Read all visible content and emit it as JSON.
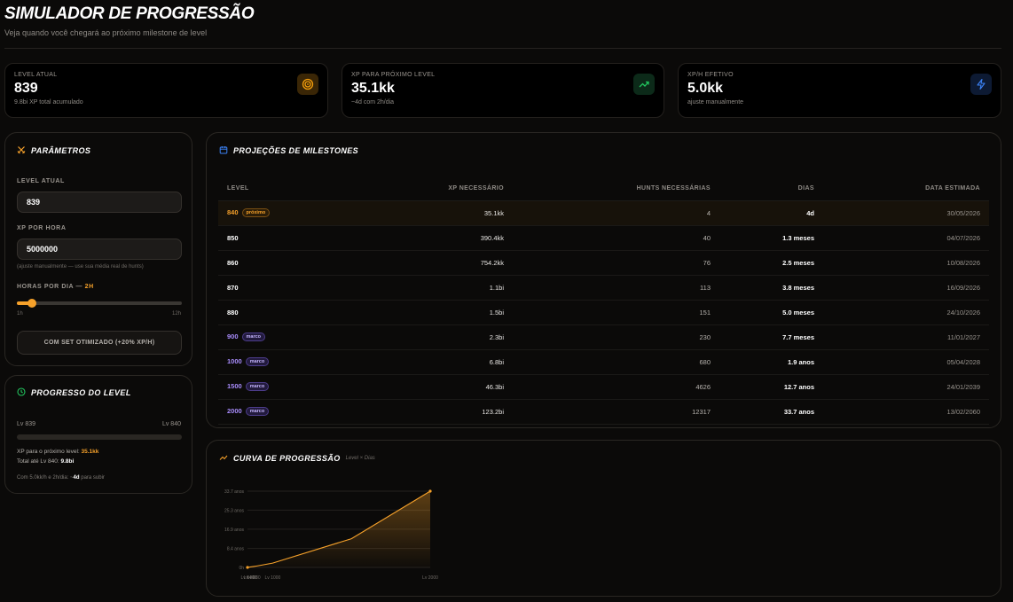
{
  "header": {
    "title": "SIMULADOR DE PROGRESSÃO",
    "subtitle": "Veja quando você chegará ao próximo milestone de level"
  },
  "stats": [
    {
      "label": "LEVEL ATUAL",
      "value": "839",
      "sub": "9.8bi XP total acumulado",
      "icon": "target-icon",
      "color": "#f59e0b"
    },
    {
      "label": "XP PARA PRÓXIMO LEVEL",
      "value": "35.1kk",
      "sub": "~4d com 2h/dia",
      "icon": "trending-up-icon",
      "color": "#22c55e"
    },
    {
      "label": "XP/H EFETIVO",
      "value": "5.0kk",
      "sub": "ajuste manualmente",
      "icon": "lightning-icon",
      "color": "#3b82f6"
    }
  ],
  "params": {
    "title": "PARÂMETROS",
    "level_label": "LEVEL ATUAL",
    "level_value": "839",
    "xp_label": "XP POR HORA",
    "xp_value": "5000000",
    "xp_hint": "(ajuste manualmente — use sua média real de hunts)",
    "hours_label": "HORAS POR DIA —",
    "hours_value": "2H",
    "hours_fraction": 0.0909,
    "slider_min": "1h",
    "slider_max": "12h",
    "set_button": "COM SET OTIMIZADO (+20% XP/H)"
  },
  "progress": {
    "title": "PROGRESSO DO LEVEL",
    "from": "Lv 839",
    "to": "Lv 840",
    "fill": 0,
    "xp_next_label": "XP para o próximo level:",
    "xp_next_value": "35.1kk",
    "total_label": "Total até Lv 840:",
    "total_value": "9.8bi",
    "eta_prefix": "Com 5.0kk/h e 2h/dia: ~",
    "eta_value": "4d",
    "eta_suffix": " para subir"
  },
  "milestones": {
    "title": "PROJEÇÕES DE MILESTONES",
    "columns": [
      "LEVEL",
      "XP NECESSÁRIO",
      "HUNTS NECESSÁRIAS",
      "DIAS",
      "DATA ESTIMADA"
    ],
    "rows": [
      {
        "level": "840",
        "badge": "próximo",
        "kind": "next",
        "xp": "35.1kk",
        "hunts": "4",
        "dias": "4d",
        "data": "30/05/2026"
      },
      {
        "level": "850",
        "badge": "",
        "kind": "",
        "xp": "390.4kk",
        "hunts": "40",
        "dias": "1.3 meses",
        "data": "04/07/2026"
      },
      {
        "level": "860",
        "badge": "",
        "kind": "",
        "xp": "754.2kk",
        "hunts": "76",
        "dias": "2.5 meses",
        "data": "10/08/2026"
      },
      {
        "level": "870",
        "badge": "",
        "kind": "",
        "xp": "1.1bi",
        "hunts": "113",
        "dias": "3.8 meses",
        "data": "16/09/2026"
      },
      {
        "level": "880",
        "badge": "",
        "kind": "",
        "xp": "1.5bi",
        "hunts": "151",
        "dias": "5.0 meses",
        "data": "24/10/2026"
      },
      {
        "level": "900",
        "badge": "marco",
        "kind": "marco",
        "xp": "2.3bi",
        "hunts": "230",
        "dias": "7.7 meses",
        "data": "11/01/2027"
      },
      {
        "level": "1000",
        "badge": "marco",
        "kind": "marco",
        "xp": "6.8bi",
        "hunts": "680",
        "dias": "1.9 anos",
        "data": "05/04/2028"
      },
      {
        "level": "1500",
        "badge": "marco",
        "kind": "marco",
        "xp": "46.3bi",
        "hunts": "4626",
        "dias": "12.7 anos",
        "data": "24/01/2039"
      },
      {
        "level": "2000",
        "badge": "marco",
        "kind": "marco",
        "xp": "123.2bi",
        "hunts": "12317",
        "dias": "33.7 anos",
        "data": "13/02/2060"
      }
    ]
  },
  "curve": {
    "title": "CURVA DE PROGRESSÃO",
    "subtitle": "Level × Dias"
  },
  "chart_data": {
    "type": "area",
    "x": [
      840,
      850,
      860,
      870,
      880,
      900,
      1000,
      1500,
      2000
    ],
    "y": [
      0.011,
      0.108,
      0.208,
      0.317,
      0.417,
      0.642,
      1.9,
      12.7,
      33.7
    ],
    "x_tick_labels": [
      "Lv 840",
      "Lv 860",
      "Lv 880",
      "Lv 1000",
      "Lv 2000"
    ],
    "y_ticks": [
      0,
      8.4,
      16.9,
      25.3,
      33.7
    ],
    "y_tick_labels": [
      "0h",
      "8.4 anos",
      "16.9 anos",
      "25.3 anos",
      "33.7 anos"
    ],
    "ylim": [
      0,
      33.7
    ],
    "grid": true,
    "color": "#f6a12a"
  }
}
